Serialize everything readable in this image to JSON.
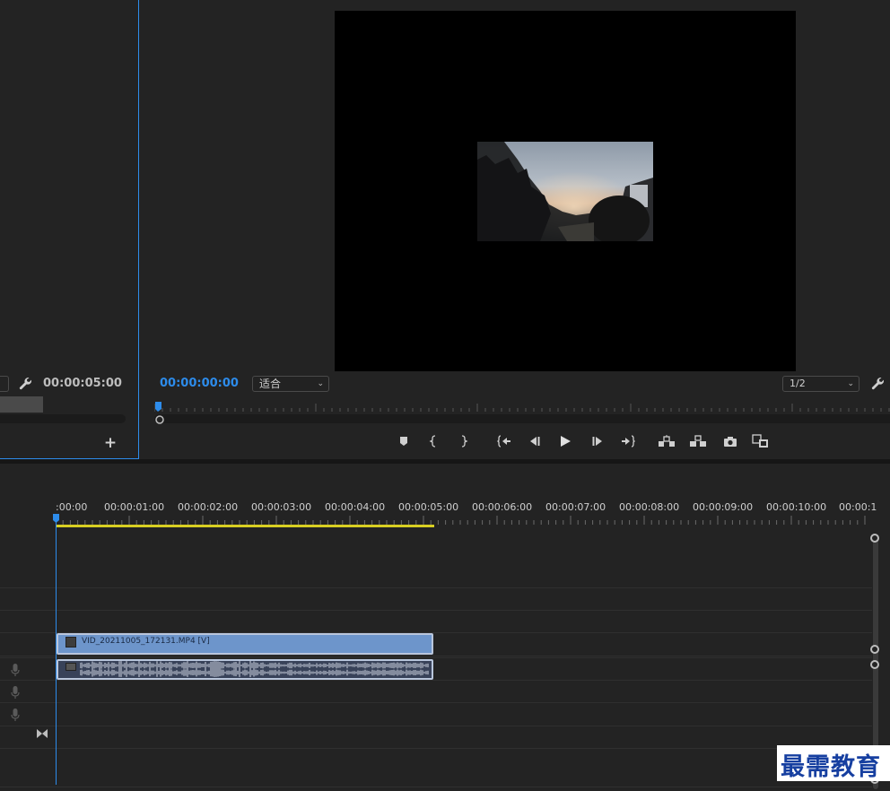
{
  "source": {
    "duration": "00:00:05:00",
    "add_button": "+"
  },
  "program": {
    "timecode": "00:00:00:00",
    "fit_select": "适合",
    "resolution_select": "1/2",
    "transport": [
      "add-marker",
      "mark-in",
      "mark-out",
      "go-to-in",
      "step-back",
      "play",
      "step-forward",
      "go-to-out",
      "lift",
      "extract",
      "export-frame",
      "compare"
    ]
  },
  "timeline": {
    "ruler": [
      ":00:00",
      "00:00:01:00",
      "00:00:02:00",
      "00:00:03:00",
      "00:00:04:00",
      "00:00:05:00",
      "00:00:06:00",
      "00:00:07:00",
      "00:00:08:00",
      "00:00:09:00",
      "00:00:10:00",
      "00:00:1"
    ],
    "video_clip_label": "VID_20211005_172131.MP4 [V]"
  },
  "watermark": {
    "text": "最需教育"
  },
  "colors": {
    "accent": "#2d8ceb",
    "work_area": "#d8cf22",
    "video_clip": "#6d95cb",
    "audio_clip": "#384259"
  }
}
